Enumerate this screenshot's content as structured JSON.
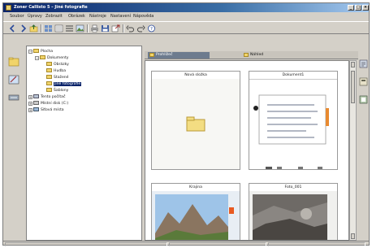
{
  "window": {
    "title": "Zoner Callisto 5 – Jiné fotografie",
    "min": "_",
    "max": "□",
    "close": "×"
  },
  "menu": [
    "Soubor",
    "Úpravy",
    "Zobrazit",
    "Obrázek",
    "Nástroje",
    "Nastavení",
    "Nápověda"
  ],
  "toolbar": {
    "icons": [
      "back-icon",
      "forward-icon",
      "up-icon",
      "view-thumbnails-icon",
      "view-details-icon",
      "view-list-icon",
      "image-icon",
      "print-icon",
      "save-icon",
      "export-icon",
      "undo-icon",
      "redo-icon",
      "help-icon"
    ]
  },
  "left_strip": {
    "icons": [
      "browse-icon",
      "edit-icon",
      "tools-icon"
    ]
  },
  "tree": {
    "nodes": [
      {
        "label": "Plocha",
        "depth": 0,
        "expander": "−"
      },
      {
        "label": "Dokumenty",
        "depth": 1,
        "expander": "−"
      },
      {
        "label": "Obrázky",
        "depth": 2,
        "expander": ""
      },
      {
        "label": "Hudba",
        "depth": 2,
        "expander": ""
      },
      {
        "label": "Stažené",
        "depth": 2,
        "expander": ""
      },
      {
        "label": "Jiné fotografie",
        "depth": 2,
        "expander": "",
        "selected": true
      },
      {
        "label": "Šablony",
        "depth": 2,
        "expander": ""
      },
      {
        "label": "Tento počítač",
        "depth": 0,
        "expander": "+"
      },
      {
        "label": "Místní disk (C:)",
        "depth": 0,
        "expander": "+"
      },
      {
        "label": "Síťová místa",
        "depth": 0,
        "expander": "+"
      }
    ]
  },
  "tabs": [
    {
      "label": "Prohlížeč",
      "active": true
    },
    {
      "label": "Náhled",
      "active": false
    }
  ],
  "thumbnails": [
    {
      "caption": "Nová složka",
      "kind": "folder"
    },
    {
      "caption": "Dokument1",
      "kind": "document"
    },
    {
      "caption": "Krajina",
      "kind": "landscape"
    },
    {
      "caption": "Foto_001",
      "kind": "photo"
    }
  ],
  "right_strip": {
    "icons": [
      "info-icon",
      "properties-icon",
      "preview-icon"
    ]
  },
  "status": {
    "items": "",
    "selection": "",
    "path": ""
  }
}
